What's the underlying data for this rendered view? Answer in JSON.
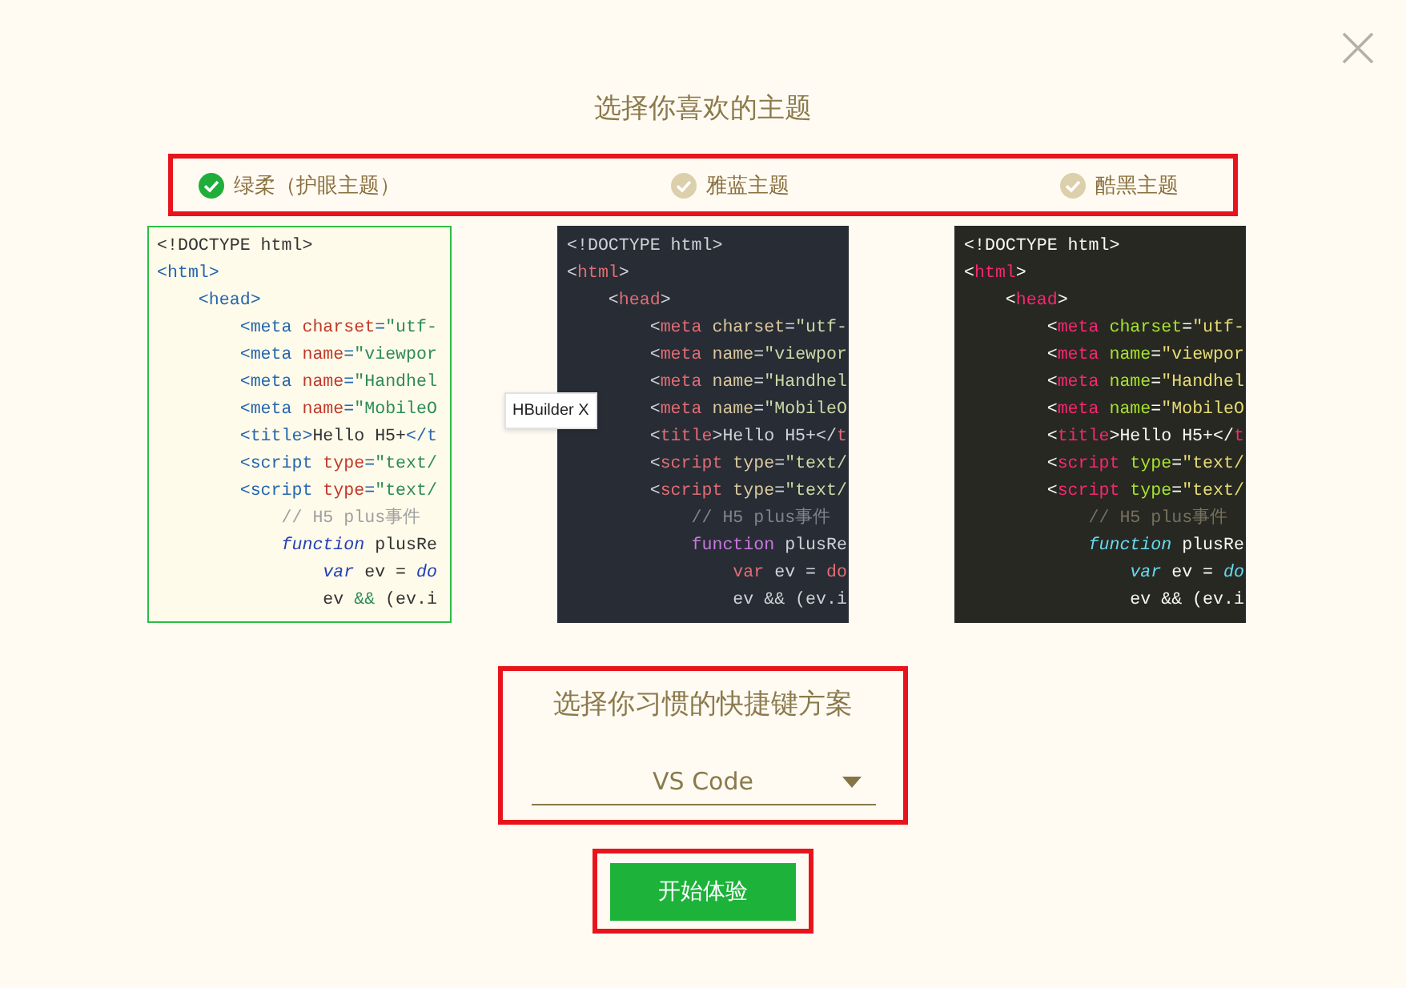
{
  "title": "选择你喜欢的主题",
  "themes": [
    {
      "label": "绿柔（护眼主题）",
      "selected": true,
      "kind": "light",
      "code": [
        [
          {
            "kind": "doctype",
            "text": "<!DOCTYPE html>"
          }
        ],
        [
          {
            "kind": "punct",
            "text": "<"
          },
          {
            "kind": "tag",
            "text": "html"
          },
          {
            "kind": "punct",
            "text": ">"
          }
        ],
        [
          {
            "kind": "punct",
            "text": "    <"
          },
          {
            "kind": "tag",
            "text": "head"
          },
          {
            "kind": "punct",
            "text": ">"
          }
        ],
        [
          {
            "kind": "punct",
            "text": "        <"
          },
          {
            "kind": "tag",
            "text": "meta"
          },
          {
            "kind": "attr",
            "text": " charset"
          },
          {
            "kind": "punct",
            "text": "="
          },
          {
            "kind": "str",
            "text": "\"utf-"
          }
        ],
        [
          {
            "kind": "punct",
            "text": "        <"
          },
          {
            "kind": "tag",
            "text": "meta"
          },
          {
            "kind": "attr",
            "text": " name"
          },
          {
            "kind": "punct",
            "text": "="
          },
          {
            "kind": "str",
            "text": "\"viewpor"
          }
        ],
        [
          {
            "kind": "punct",
            "text": "        <"
          },
          {
            "kind": "tag",
            "text": "meta"
          },
          {
            "kind": "attr",
            "text": " name"
          },
          {
            "kind": "punct",
            "text": "="
          },
          {
            "kind": "str",
            "text": "\"Handhel"
          }
        ],
        [
          {
            "kind": "punct",
            "text": "        <"
          },
          {
            "kind": "tag",
            "text": "meta"
          },
          {
            "kind": "attr",
            "text": " name"
          },
          {
            "kind": "punct",
            "text": "="
          },
          {
            "kind": "str",
            "text": "\"MobileO"
          }
        ],
        [
          {
            "kind": "punct",
            "text": "        <"
          },
          {
            "kind": "tag",
            "text": "title"
          },
          {
            "kind": "punct",
            "text": ">"
          },
          {
            "kind": "text",
            "text": "Hello H5+"
          },
          {
            "kind": "punct",
            "text": "</"
          },
          {
            "kind": "tag",
            "text": "t"
          }
        ],
        [
          {
            "kind": "punct",
            "text": "        <"
          },
          {
            "kind": "tag",
            "text": "script"
          },
          {
            "kind": "attr",
            "text": " type"
          },
          {
            "kind": "punct",
            "text": "="
          },
          {
            "kind": "str",
            "text": "\"text/"
          }
        ],
        [
          {
            "kind": "punct",
            "text": "        <"
          },
          {
            "kind": "tag",
            "text": "script"
          },
          {
            "kind": "attr",
            "text": " type"
          },
          {
            "kind": "punct",
            "text": "="
          },
          {
            "kind": "str",
            "text": "\"text/"
          }
        ],
        [
          {
            "kind": "comment",
            "text": "            // H5 plus事件"
          }
        ],
        [
          {
            "kind": "keyword",
            "text": "            function"
          },
          {
            "kind": "text",
            "text": " plusRe"
          }
        ],
        [
          {
            "kind": "storage",
            "text": "                var"
          },
          {
            "kind": "text",
            "text": " ev = "
          },
          {
            "kind": "storage",
            "text": "do"
          }
        ],
        [
          {
            "kind": "text",
            "text": "                ev "
          },
          {
            "kind": "op",
            "text": "&&"
          },
          {
            "kind": "text",
            "text": " (ev.i"
          }
        ]
      ]
    },
    {
      "label": "雅蓝主题",
      "selected": false,
      "kind": "blue",
      "code": [
        [
          {
            "kind": "doctype",
            "text": "<!DOCTYPE html>"
          }
        ],
        [
          {
            "kind": "punct",
            "text": "<"
          },
          {
            "kind": "tag",
            "text": "html"
          },
          {
            "kind": "punct",
            "text": ">"
          }
        ],
        [
          {
            "kind": "punct",
            "text": "    <"
          },
          {
            "kind": "tag",
            "text": "head"
          },
          {
            "kind": "punct",
            "text": ">"
          }
        ],
        [
          {
            "kind": "punct",
            "text": "        <"
          },
          {
            "kind": "tag",
            "text": "meta"
          },
          {
            "kind": "attr",
            "text": " charset"
          },
          {
            "kind": "punct",
            "text": "="
          },
          {
            "kind": "str",
            "text": "\"utf-"
          }
        ],
        [
          {
            "kind": "punct",
            "text": "        <"
          },
          {
            "kind": "tag",
            "text": "meta"
          },
          {
            "kind": "attr",
            "text": " name"
          },
          {
            "kind": "punct",
            "text": "="
          },
          {
            "kind": "str",
            "text": "\"viewpor"
          }
        ],
        [
          {
            "kind": "punct",
            "text": "        <"
          },
          {
            "kind": "tag",
            "text": "meta"
          },
          {
            "kind": "attr",
            "text": " name"
          },
          {
            "kind": "punct",
            "text": "="
          },
          {
            "kind": "str",
            "text": "\"Handhel"
          }
        ],
        [
          {
            "kind": "punct",
            "text": "        <"
          },
          {
            "kind": "tag",
            "text": "meta"
          },
          {
            "kind": "attr",
            "text": " name"
          },
          {
            "kind": "punct",
            "text": "="
          },
          {
            "kind": "str",
            "text": "\"MobileO"
          }
        ],
        [
          {
            "kind": "punct",
            "text": "        <"
          },
          {
            "kind": "tag",
            "text": "title"
          },
          {
            "kind": "punct",
            "text": ">"
          },
          {
            "kind": "text",
            "text": "Hello H5+"
          },
          {
            "kind": "punct",
            "text": "</"
          },
          {
            "kind": "tag",
            "text": "t"
          }
        ],
        [
          {
            "kind": "punct",
            "text": "        <"
          },
          {
            "kind": "tag",
            "text": "script"
          },
          {
            "kind": "attr",
            "text": " type"
          },
          {
            "kind": "punct",
            "text": "="
          },
          {
            "kind": "str",
            "text": "\"text/"
          }
        ],
        [
          {
            "kind": "punct",
            "text": "        <"
          },
          {
            "kind": "tag",
            "text": "script"
          },
          {
            "kind": "attr",
            "text": " type"
          },
          {
            "kind": "punct",
            "text": "="
          },
          {
            "kind": "str",
            "text": "\"text/"
          }
        ],
        [
          {
            "kind": "comment",
            "text": "            // H5 plus事件"
          }
        ],
        [
          {
            "kind": "keyword",
            "text": "            function"
          },
          {
            "kind": "text",
            "text": " plusRe"
          }
        ],
        [
          {
            "kind": "storage",
            "text": "                var"
          },
          {
            "kind": "text",
            "text": " ev = "
          },
          {
            "kind": "storage",
            "text": "do"
          }
        ],
        [
          {
            "kind": "text",
            "text": "                ev "
          },
          {
            "kind": "op",
            "text": "&&"
          },
          {
            "kind": "text",
            "text": " (ev.i"
          }
        ]
      ]
    },
    {
      "label": "酷黑主题",
      "selected": false,
      "kind": "dark",
      "code": [
        [
          {
            "kind": "doctype",
            "text": "<!DOCTYPE html>"
          }
        ],
        [
          {
            "kind": "punct",
            "text": "<"
          },
          {
            "kind": "tag",
            "text": "html"
          },
          {
            "kind": "punct",
            "text": ">"
          }
        ],
        [
          {
            "kind": "punct",
            "text": "    <"
          },
          {
            "kind": "tag",
            "text": "head"
          },
          {
            "kind": "punct",
            "text": ">"
          }
        ],
        [
          {
            "kind": "punct",
            "text": "        <"
          },
          {
            "kind": "tag",
            "text": "meta"
          },
          {
            "kind": "attr",
            "text": " charset"
          },
          {
            "kind": "punct",
            "text": "="
          },
          {
            "kind": "str",
            "text": "\"utf-"
          }
        ],
        [
          {
            "kind": "punct",
            "text": "        <"
          },
          {
            "kind": "tag",
            "text": "meta"
          },
          {
            "kind": "attr",
            "text": " name"
          },
          {
            "kind": "punct",
            "text": "="
          },
          {
            "kind": "str",
            "text": "\"viewpor"
          }
        ],
        [
          {
            "kind": "punct",
            "text": "        <"
          },
          {
            "kind": "tag",
            "text": "meta"
          },
          {
            "kind": "attr",
            "text": " name"
          },
          {
            "kind": "punct",
            "text": "="
          },
          {
            "kind": "str",
            "text": "\"Handhel"
          }
        ],
        [
          {
            "kind": "punct",
            "text": "        <"
          },
          {
            "kind": "tag",
            "text": "meta"
          },
          {
            "kind": "attr",
            "text": " name"
          },
          {
            "kind": "punct",
            "text": "="
          },
          {
            "kind": "str",
            "text": "\"MobileO"
          }
        ],
        [
          {
            "kind": "punct",
            "text": "        <"
          },
          {
            "kind": "tag",
            "text": "title"
          },
          {
            "kind": "punct",
            "text": ">"
          },
          {
            "kind": "text",
            "text": "Hello H5+"
          },
          {
            "kind": "punct",
            "text": "</"
          },
          {
            "kind": "tag",
            "text": "t"
          }
        ],
        [
          {
            "kind": "punct",
            "text": "        <"
          },
          {
            "kind": "tag",
            "text": "script"
          },
          {
            "kind": "attr",
            "text": " type"
          },
          {
            "kind": "punct",
            "text": "="
          },
          {
            "kind": "str",
            "text": "\"text/"
          }
        ],
        [
          {
            "kind": "punct",
            "text": "        <"
          },
          {
            "kind": "tag",
            "text": "script"
          },
          {
            "kind": "attr",
            "text": " type"
          },
          {
            "kind": "punct",
            "text": "="
          },
          {
            "kind": "str",
            "text": "\"text/"
          }
        ],
        [
          {
            "kind": "comment",
            "text": "            // H5 plus事件"
          }
        ],
        [
          {
            "kind": "keyword",
            "text": "            function"
          },
          {
            "kind": "text",
            "text": " plusRe"
          }
        ],
        [
          {
            "kind": "storage",
            "text": "                var"
          },
          {
            "kind": "text",
            "text": " ev = "
          },
          {
            "kind": "storage",
            "text": "do"
          }
        ],
        [
          {
            "kind": "text",
            "text": "                ev "
          },
          {
            "kind": "op",
            "text": "&&"
          },
          {
            "kind": "text",
            "text": " (ev.i"
          }
        ]
      ]
    }
  ],
  "tooltip": "HBuilder X",
  "shortcut": {
    "title": "选择你习惯的快捷键方案",
    "value": "VS Code"
  },
  "start_button": "开始体验"
}
